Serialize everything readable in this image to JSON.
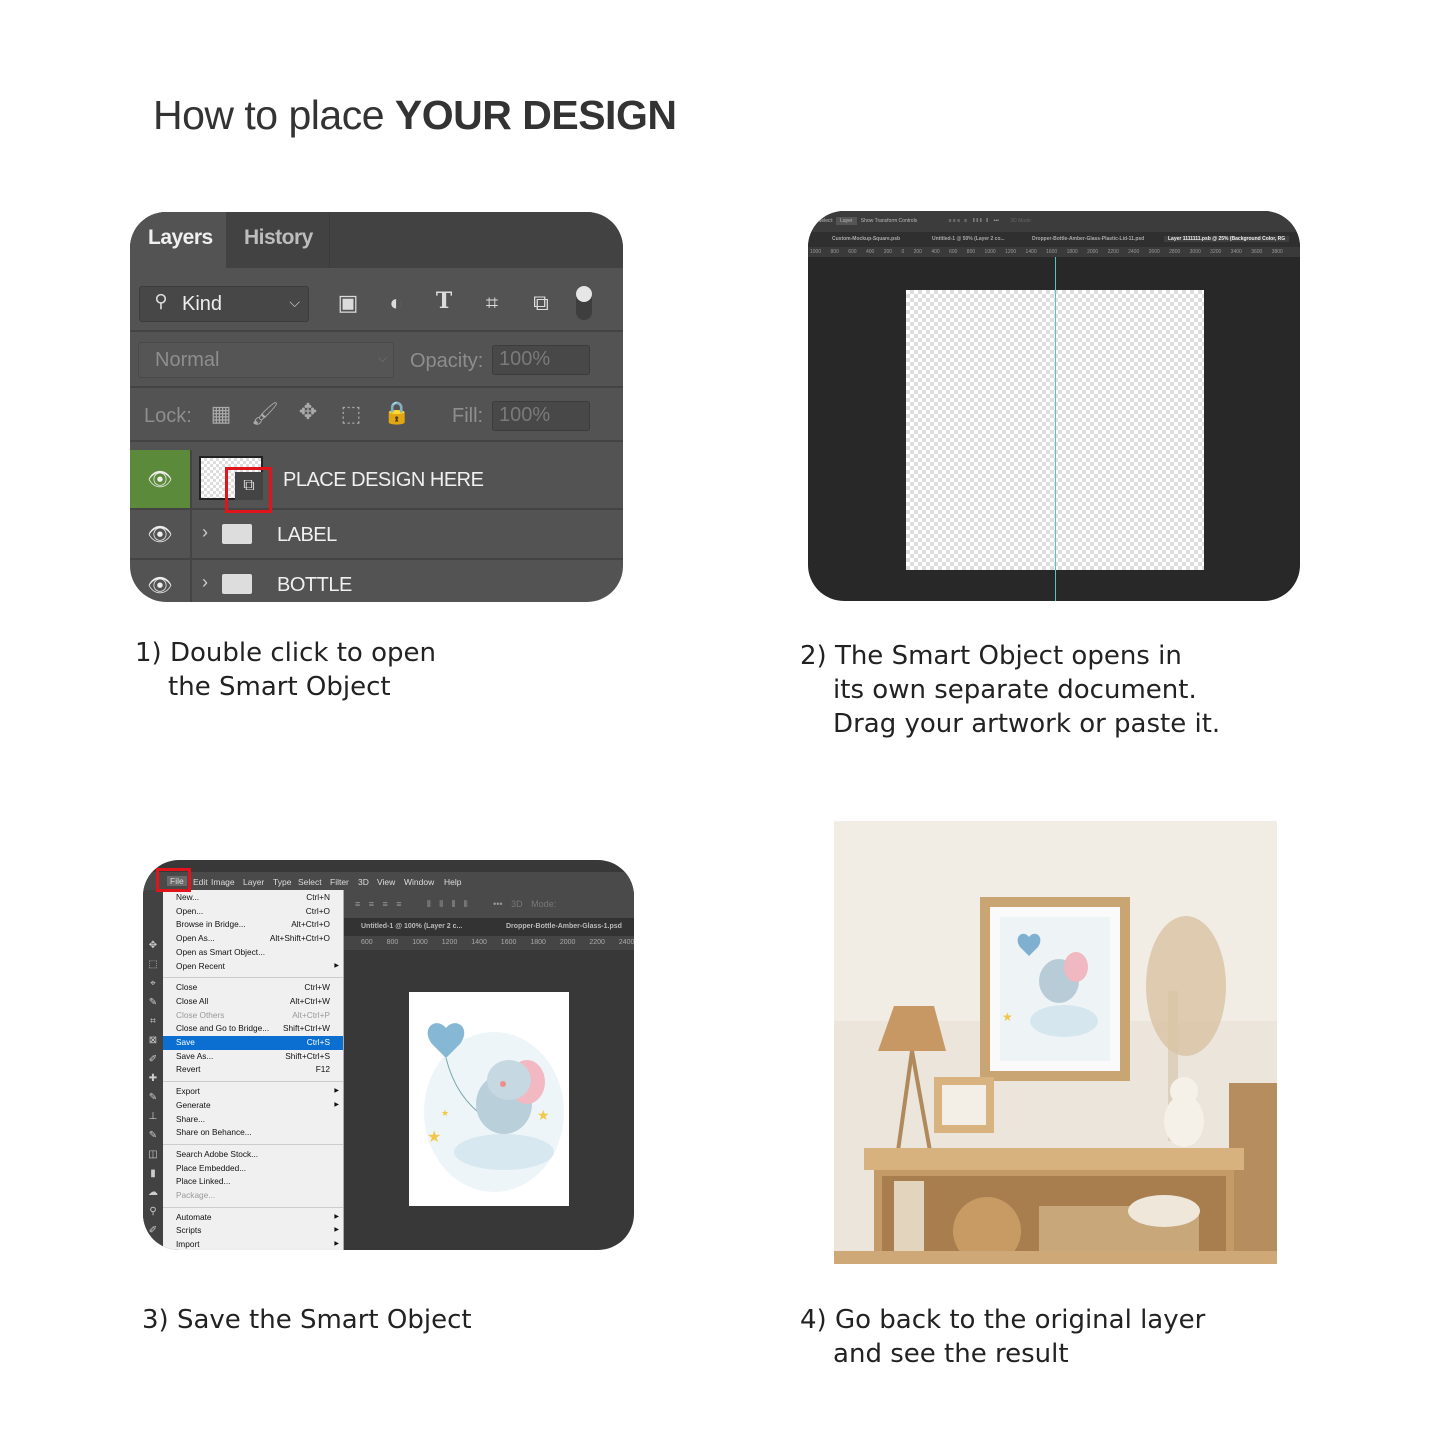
{
  "title": {
    "prefix": "How to place ",
    "emphasis": "YOUR DESIGN"
  },
  "steps": [
    {
      "caption": "1) Double click to open\n    the Smart Object"
    },
    {
      "caption": "2) The Smart Object opens in\n    its own separate document.\n    Drag your artwork or paste it."
    },
    {
      "caption": "3) Save the Smart Object"
    },
    {
      "caption": "4) Go back to the original layer\n    and see the result"
    }
  ],
  "layers_panel": {
    "tabs": [
      "Layers",
      "History"
    ],
    "filter_kind": "Kind",
    "blend_mode": "Normal",
    "opacity_label": "Opacity:",
    "opacity_value": "100%",
    "lock_label": "Lock:",
    "fill_label": "Fill:",
    "fill_value": "100%",
    "layers": [
      {
        "name": "PLACE DESIGN HERE",
        "type": "smart-object",
        "visible": true,
        "selected": true
      },
      {
        "name": "LABEL",
        "type": "group",
        "visible": true
      },
      {
        "name": "BOTTLE",
        "type": "group",
        "visible": true
      }
    ],
    "highlight_color": "#e0151c",
    "eye_active_color": "#5b8a3a"
  },
  "smart_object_doc": {
    "options": [
      "Select:",
      "Layer",
      "Show Transform Controls",
      "3D Mode:"
    ],
    "tabs": [
      "Custom-Mockup-Square.psb",
      "Untitled-1 @ 50% (Layer 2 co...",
      "Dropper-Bottle-Amber-Glass-Plastic-Lid-11.psd",
      "Layer 1111111.psb @ 25% (Background Color, RG"
    ],
    "ruler": "1000 800 600 400 200 0 200 400 600 800 1000 1200 1400 1600 1800 2000 2200 2400 2600 2800 3000 3200 3400 3600 3800"
  },
  "file_menu": {
    "menubar": [
      "File",
      "Edit",
      "Image",
      "Layer",
      "Type",
      "Select",
      "Filter",
      "3D",
      "View",
      "Window",
      "Help"
    ],
    "groups": [
      [
        {
          "label": "New...",
          "shortcut": "Ctrl+N"
        },
        {
          "label": "Open...",
          "shortcut": "Ctrl+O"
        },
        {
          "label": "Browse in Bridge...",
          "shortcut": "Alt+Ctrl+O"
        },
        {
          "label": "Open As...",
          "shortcut": "Alt+Shift+Ctrl+O"
        },
        {
          "label": "Open as Smart Object...",
          "shortcut": ""
        },
        {
          "label": "Open Recent",
          "shortcut": "",
          "submenu": true
        }
      ],
      [
        {
          "label": "Close",
          "shortcut": "Ctrl+W"
        },
        {
          "label": "Close All",
          "shortcut": "Alt+Ctrl+W"
        },
        {
          "label": "Close Others",
          "shortcut": "Alt+Ctrl+P",
          "disabled": true
        },
        {
          "label": "Close and Go to Bridge...",
          "shortcut": "Shift+Ctrl+W"
        },
        {
          "label": "Save",
          "shortcut": "Ctrl+S",
          "selected": true
        },
        {
          "label": "Save As...",
          "shortcut": "Shift+Ctrl+S"
        },
        {
          "label": "Revert",
          "shortcut": "F12"
        }
      ],
      [
        {
          "label": "Export",
          "shortcut": "",
          "submenu": true
        },
        {
          "label": "Generate",
          "shortcut": "",
          "submenu": true
        },
        {
          "label": "Share...",
          "shortcut": ""
        },
        {
          "label": "Share on Behance...",
          "shortcut": ""
        }
      ],
      [
        {
          "label": "Search Adobe Stock...",
          "shortcut": ""
        },
        {
          "label": "Place Embedded...",
          "shortcut": ""
        },
        {
          "label": "Place Linked...",
          "shortcut": ""
        },
        {
          "label": "Package...",
          "shortcut": "",
          "disabled": true
        }
      ],
      [
        {
          "label": "Automate",
          "shortcut": "",
          "submenu": true
        },
        {
          "label": "Scripts",
          "shortcut": "",
          "submenu": true
        },
        {
          "label": "Import",
          "shortcut": "",
          "submenu": true
        }
      ]
    ],
    "options_bar": "3D Mode:",
    "doc_tabs": [
      "Untitled-1 @ 100% (Layer 2 c...",
      "Dropper-Bottle-Amber-Glass-1.psd"
    ],
    "ruler": "600 800 1000 1200 1400 1600 1800 2000 2200 2400",
    "selected_color": "#0a6fd0"
  }
}
